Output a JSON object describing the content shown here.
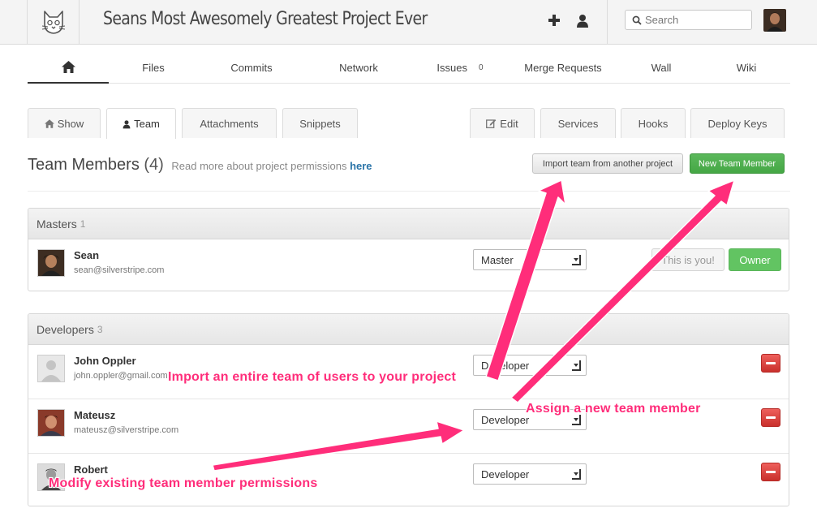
{
  "header": {
    "project_title": "Seans Most Awesomely Greatest Project Ever",
    "search_placeholder": "Search",
    "icons": [
      "gitlab-logo-icon",
      "plus-icon",
      "user-icon",
      "search-icon"
    ]
  },
  "main_nav": {
    "items": [
      {
        "label": "Files"
      },
      {
        "label": "Commits"
      },
      {
        "label": "Network"
      },
      {
        "label": "Issues",
        "count": "0"
      },
      {
        "label": "Merge Requests"
      },
      {
        "label": "Wall"
      },
      {
        "label": "Wiki"
      }
    ]
  },
  "tabs": {
    "show": "Show",
    "team": "Team",
    "attachments": "Attachments",
    "snippets": "Snippets",
    "edit": "Edit",
    "services": "Services",
    "hooks": "Hooks",
    "deploy_keys": "Deploy Keys"
  },
  "page": {
    "title": "Team Members",
    "count": "(4)",
    "note": "Read more about project permissions",
    "note_link": "here",
    "import_button": "Import team from another project",
    "new_member_button": "New Team Member"
  },
  "masters": {
    "heading": "Masters",
    "count": "1",
    "members": [
      {
        "name": "Sean",
        "email": "sean@silverstripe.com",
        "role": "Master",
        "you_label": "This is you!",
        "owner_label": "Owner"
      }
    ]
  },
  "developers": {
    "heading": "Developers",
    "count": "3",
    "members": [
      {
        "name": "John Oppler",
        "email": "john.oppler@gmail.com",
        "role": "Developer"
      },
      {
        "name": "Mateusz",
        "email": "mateusz@silverstripe.com",
        "role": "Developer"
      },
      {
        "name": "Robert",
        "email": "",
        "role": "Developer"
      }
    ]
  },
  "annotations": {
    "color": "#ff2d7a",
    "import": "Import an entire team of users to your project",
    "assign": "Assign a new team member",
    "modify": "Modify existing team member permissions"
  }
}
